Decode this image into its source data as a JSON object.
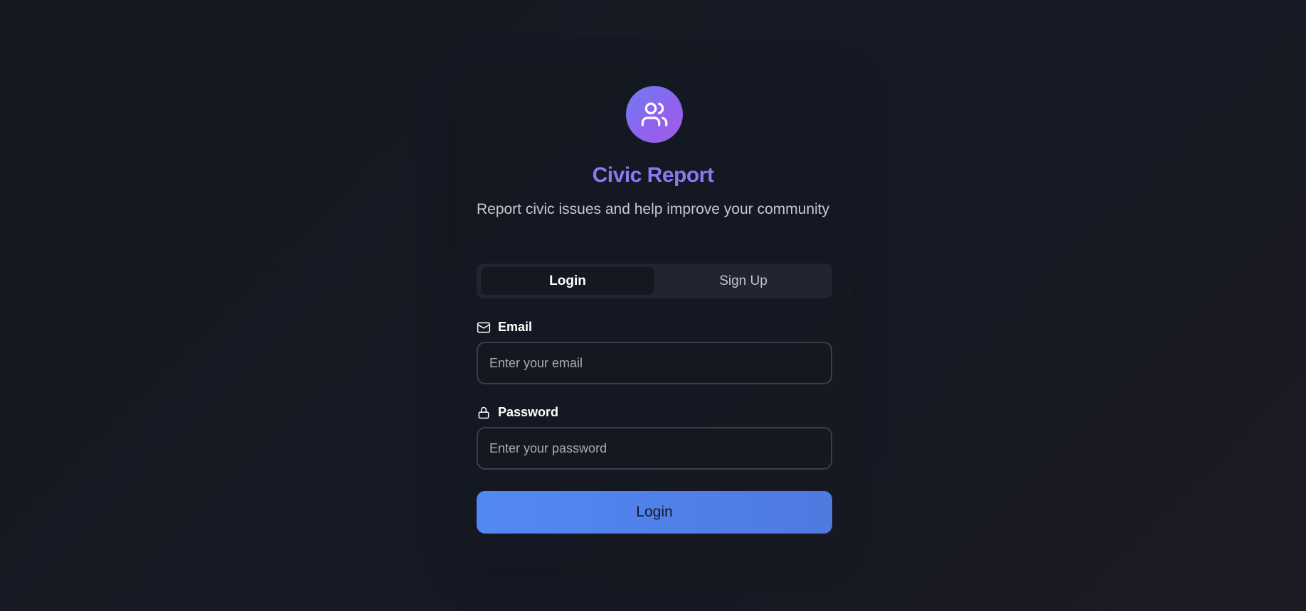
{
  "brand": {
    "title": "Civic Report",
    "subtitle": "Report civic issues and help improve your community",
    "logo_icon": "users-icon"
  },
  "tabs": [
    {
      "label": "Login",
      "active": true
    },
    {
      "label": "Sign Up",
      "active": false
    }
  ],
  "form": {
    "email": {
      "label": "Email",
      "icon": "mail-icon",
      "placeholder": "Enter your email",
      "value": ""
    },
    "password": {
      "label": "Password",
      "icon": "lock-icon",
      "placeholder": "Enter your password",
      "value": ""
    },
    "submit_label": "Login"
  },
  "colors": {
    "accent": "#5288f3",
    "brand_gradient_start": "#6b7ef2",
    "brand_gradient_end": "#a15ae8",
    "background": "#151a24"
  }
}
